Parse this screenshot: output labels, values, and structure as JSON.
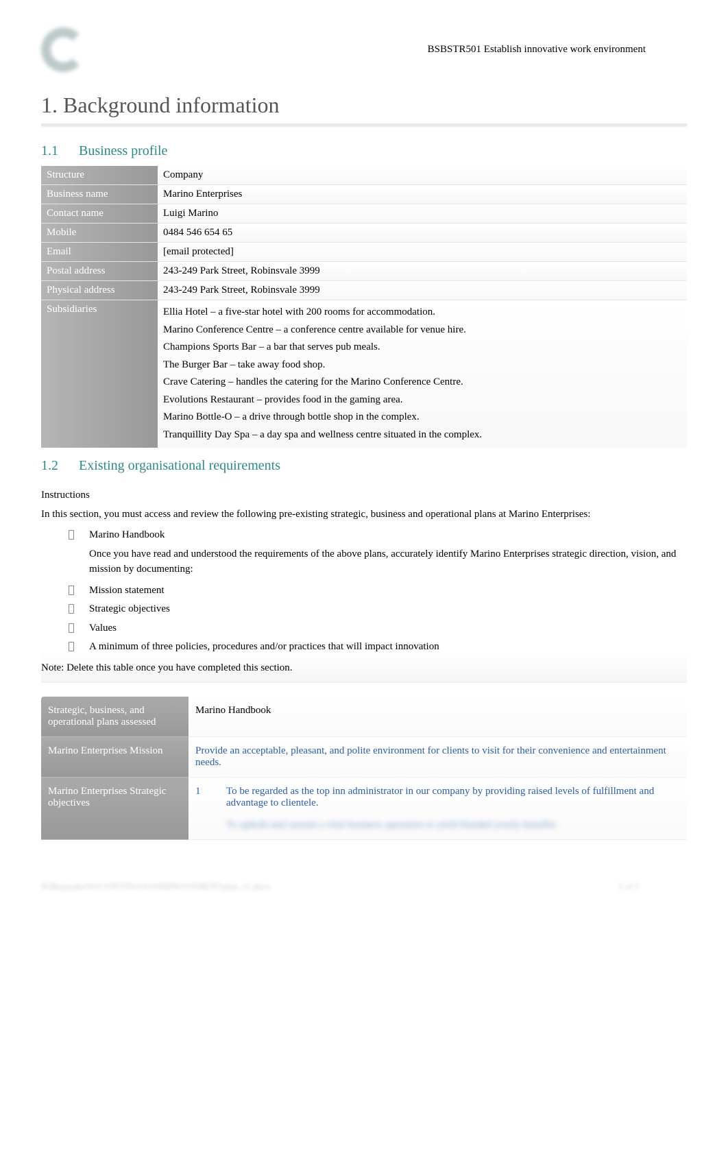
{
  "course_code": "BSBSTR501 Establish innovative work environment",
  "sections": {
    "s1": {
      "title": "1. Background information",
      "s1_1": {
        "title_num": "1.1",
        "title_text": "Business profile",
        "rows": {
          "structure": {
            "label": "Structure",
            "value": "Company"
          },
          "business_name": {
            "label": "Business name",
            "value": "Marino Enterprises"
          },
          "contact_name": {
            "label": "Contact name",
            "value": "Luigi Marino"
          },
          "mobile": {
            "label": "Mobile",
            "value": "0484 546 654 65"
          },
          "email": {
            "label": "Email",
            "value": "[email protected]"
          },
          "postal_address": {
            "label": "Postal address",
            "value": "243-249 Park Street, Robinsvale 3999"
          },
          "physical_address": {
            "label": "Physical address",
            "value": "243-249 Park Street, Robinsvale 3999"
          },
          "subsidiaries": {
            "label": "Subsidiaries",
            "lines": [
              "Ellia Hotel – a five-star hotel with 200 rooms for accommodation.",
              "Marino Conference Centre – a conference centre available for venue hire.",
              "Champions Sports Bar – a bar that serves pub meals.",
              "The Burger Bar – take away food shop.",
              "Crave Catering – handles the catering for the Marino Conference Centre.",
              "Evolutions Restaurant – provides food in the gaming area.",
              "Marino Bottle-O – a drive through bottle shop in the complex.",
              "Tranquillity Day Spa – a day spa and wellness centre situated in the complex."
            ]
          }
        }
      },
      "s1_2": {
        "title_num": "1.2",
        "title_text": "Existing organisational requirements",
        "instructions": {
          "title": "Instructions",
          "intro": "In this section, you must access and review the following pre-existing strategic, business and operational plans at Marino Enterprises:",
          "bullet1": "Marino Handbook",
          "subtext": "Once you have read and understood the requirements of the above plans, accurately identify Marino Enterprises strategic direction, vision, and mission by documenting:",
          "bullets2": [
            "Mission statement",
            "Strategic objectives",
            "Values",
            "A minimum of three policies, procedures and/or practices that will impact innovation"
          ],
          "note": "Note: Delete this table once you have completed this section."
        },
        "plans_table": {
          "row1": {
            "label": "Strategic, business, and operational plans assessed",
            "value": "Marino Handbook"
          },
          "row2": {
            "label": "Marino Enterprises Mission",
            "value": "Provide an acceptable, pleasant, and polite environment for clients to visit for their convenience and entertainment needs."
          },
          "row3": {
            "label": "Marino Enterprises Strategic objectives",
            "obj1_num": "1",
            "obj1_text": "To be regarded as the top inn administrator in our company by providing raised levels of fulfillment and advantage to clientele.",
            "obj_blur": "To uphold and sustain a vital business operation to yield blended yearly benefits."
          }
        }
      }
    }
  },
  "footer": {
    "left": "BSBopsadm501CONTINUOUSIMPROVEMENTplan_v1.docx",
    "right": "1 of 5"
  }
}
